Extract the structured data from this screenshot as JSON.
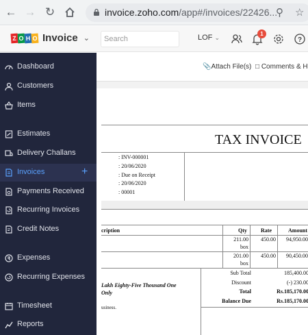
{
  "browser": {
    "url_host": "invoice.zoho.com",
    "url_path": "/app#/invoices/22426..."
  },
  "app": {
    "logo_text": "Invoice",
    "search_placeholder": "Search",
    "org": "LOF",
    "notifications_count": "1"
  },
  "sidebar": {
    "items": [
      {
        "label": "Dashboard",
        "icon": "dashboard-icon"
      },
      {
        "label": "Customers",
        "icon": "user-icon"
      },
      {
        "label": "Items",
        "icon": "basket-icon"
      },
      {
        "label": "Estimates",
        "icon": "estimate-icon"
      },
      {
        "label": "Delivery Challans",
        "icon": "truck-icon"
      },
      {
        "label": "Invoices",
        "icon": "document-icon",
        "active": true
      },
      {
        "label": "Payments Received",
        "icon": "payment-icon"
      },
      {
        "label": "Recurring Invoices",
        "icon": "recurring-icon"
      },
      {
        "label": "Credit Notes",
        "icon": "credit-note-icon"
      },
      {
        "label": "Expenses",
        "icon": "expense-icon"
      },
      {
        "label": "Recurring Expenses",
        "icon": "recurring-expense-icon"
      },
      {
        "label": "Timesheet",
        "icon": "timesheet-icon"
      },
      {
        "label": "Reports",
        "icon": "reports-icon"
      }
    ],
    "add_symbol": "+"
  },
  "toolbar": {
    "attach": "Attach File(s)",
    "comments": "Comments & Hi"
  },
  "invoice": {
    "title": "TAX INVOICE",
    "meta": [
      ": INV-000001",
      ": 20/06/2020",
      ": Due on Receipt",
      ": 20/06/2020",
      ": 00001"
    ],
    "columns": {
      "desc": "cription",
      "qty": "Qty",
      "rate": "Rate",
      "amount": "Amount"
    },
    "rows": [
      {
        "qty": "211.00",
        "unit": "box",
        "rate": "450.00",
        "amount": "94,950.00"
      },
      {
        "qty": "201.00",
        "unit": "box",
        "rate": "450.00",
        "amount": "90,450.00"
      }
    ],
    "amount_words_1": "Lakh Eighty-Five Thousand One",
    "amount_words_2": "Only",
    "thanks": "usiness.",
    "totals": {
      "sub_total_label": "Sub Total",
      "sub_total": "185,400.00",
      "discount_label": "Discount",
      "discount": "(-) 230.00",
      "total_label": "Total",
      "total": "Rs.185,170.00",
      "balance_label": "Balance Due",
      "balance": "Rs.185,170.00"
    }
  }
}
